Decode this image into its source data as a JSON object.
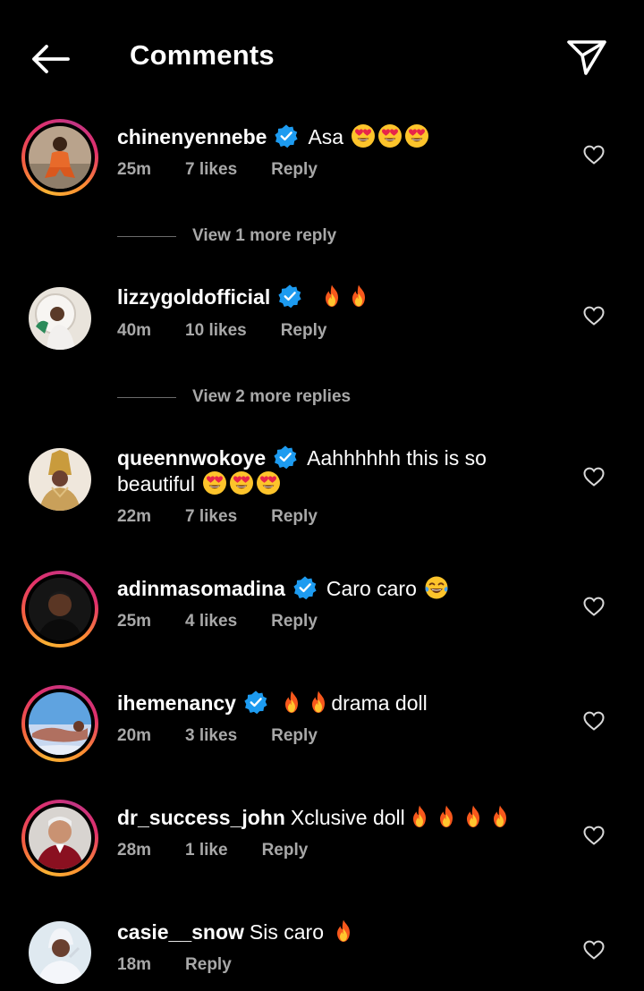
{
  "header": {
    "title": "Comments",
    "back_icon": "arrow-left-icon",
    "share_icon": "paper-plane-icon"
  },
  "colors": {
    "background": "#000000",
    "text": "#ffffff",
    "muted": "#a8a8a8",
    "verified": "#1d9bf0"
  },
  "comments": [
    {
      "username": "chinenyennebe",
      "verified": true,
      "text": "Asa",
      "emoji": [
        "heart-eyes",
        "heart-eyes",
        "heart-eyes"
      ],
      "time": "25m",
      "likes": "7 likes",
      "reply": "Reply",
      "view_replies": "View 1 more reply"
    },
    {
      "username": "lizzygoldofficial",
      "verified": true,
      "text": "",
      "emoji": [
        "fire",
        "fire"
      ],
      "time": "40m",
      "likes": "10 likes",
      "reply": "Reply",
      "view_replies": "View 2 more replies"
    },
    {
      "username": "queennwokoye",
      "verified": true,
      "text": "Aahhhhhh this is so",
      "text_line2": "beautiful",
      "emoji": [
        "heart-eyes",
        "heart-eyes",
        "heart-eyes"
      ],
      "time": "22m",
      "likes": "7 likes",
      "reply": "Reply"
    },
    {
      "username": "adinmasomadina",
      "verified": true,
      "text": "Caro caro",
      "emoji": [
        "tears-of-joy"
      ],
      "time": "25m",
      "likes": "4 likes",
      "reply": "Reply"
    },
    {
      "username": "ihemenancy",
      "verified": true,
      "text": "drama doll",
      "emoji_before": [
        "fire",
        "fire"
      ],
      "time": "20m",
      "likes": "3 likes",
      "reply": "Reply"
    },
    {
      "username": "dr_success_john",
      "verified": false,
      "text": "Xclusive doll",
      "emoji": [
        "fire",
        "fire",
        "fire",
        "fire"
      ],
      "time": "28m",
      "likes": "1 like",
      "reply": "Reply"
    },
    {
      "username": "casie__snow",
      "verified": false,
      "text": "Sis caro",
      "emoji": [
        "fire"
      ],
      "time": "18m",
      "reply": "Reply"
    }
  ]
}
